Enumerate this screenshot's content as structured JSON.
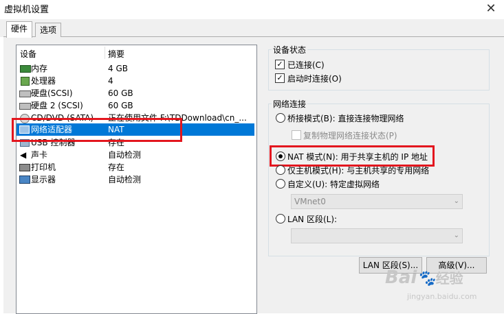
{
  "window": {
    "title": "虚拟机设置",
    "close_glyph": "✕"
  },
  "tabs": [
    {
      "label": "硬件"
    },
    {
      "label": "选项"
    }
  ],
  "device_list": {
    "col_device": "设备",
    "col_summary": "摘要",
    "rows": [
      {
        "icon": "memory-icon",
        "name": "内存",
        "summary": "4 GB"
      },
      {
        "icon": "cpu-icon",
        "name": "处理器",
        "summary": "4"
      },
      {
        "icon": "disk-icon",
        "name": "硬盘(SCSI)",
        "summary": "60 GB"
      },
      {
        "icon": "disk-icon",
        "name": "硬盘 2 (SCSI)",
        "summary": "60 GB"
      },
      {
        "icon": "cdrom-icon",
        "name": "CD/DVD (SATA)",
        "summary": "正在使用文件 F:\\TDDownload\\cn_..."
      },
      {
        "icon": "network-adapter-icon",
        "name": "网络适配器",
        "summary": "NAT"
      },
      {
        "icon": "usb-icon",
        "name": "USB 控制器",
        "summary": "存在"
      },
      {
        "icon": "speaker-icon",
        "name": "声卡",
        "summary": "自动检测"
      },
      {
        "icon": "printer-icon",
        "name": "打印机",
        "summary": "存在"
      },
      {
        "icon": "monitor-icon",
        "name": "显示器",
        "summary": "自动检测"
      }
    ],
    "selected_index": 5
  },
  "device_status": {
    "title": "设备状态",
    "connected": {
      "label": "已连接(C)",
      "checked": true
    },
    "connect_at_power_on": {
      "label": "启动时连接(O)",
      "checked": true
    }
  },
  "network_connection": {
    "title": "网络连接",
    "bridged": {
      "label": "桥接模式(B): 直接连接物理网络",
      "selected": false
    },
    "replicate": {
      "label": "复制物理网络连接状态(P)",
      "checked": false,
      "enabled": false
    },
    "nat": {
      "label": "NAT 模式(N): 用于共享主机的 IP 地址",
      "selected": true
    },
    "host_only": {
      "label": "仅主机模式(H): 与主机共享的专用网络",
      "selected": false
    },
    "custom": {
      "label": "自定义(U): 特定虚拟网络",
      "selected": false
    },
    "custom_combo": {
      "value": "VMnet0",
      "enabled": false
    },
    "lan_segment": {
      "label": "LAN 区段(L):",
      "selected": false
    },
    "lan_combo": {
      "value": "",
      "enabled": false
    }
  },
  "buttons": {
    "lan_segments": "LAN 区段(S)...",
    "advanced": "高级(V)..."
  },
  "watermark": {
    "brand": "Bai",
    "brand_cn": "经验",
    "url": "jingyan.baidu.com"
  },
  "colors": {
    "selection": "#0078d7",
    "highlight_box": "#e3161e"
  }
}
